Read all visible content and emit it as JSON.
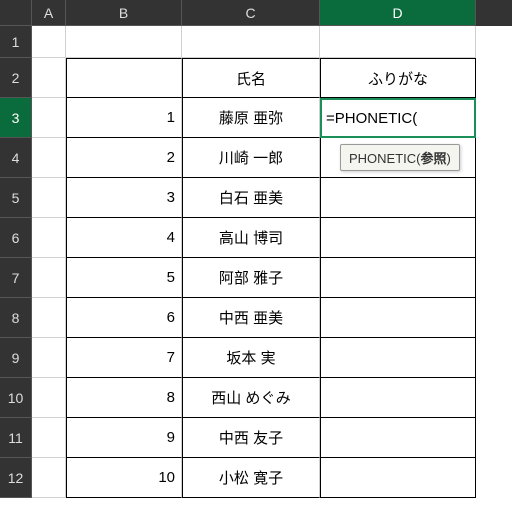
{
  "columns": [
    "A",
    "B",
    "C",
    "D"
  ],
  "rowNumbers": [
    "1",
    "2",
    "3",
    "4",
    "5",
    "6",
    "7",
    "8",
    "9",
    "10",
    "11",
    "12"
  ],
  "activeRow": 3,
  "activeCol": "D",
  "headers": {
    "name": "氏名",
    "furigana": "ふりがな"
  },
  "tableRows": [
    {
      "num": "1",
      "name": "藤原  亜弥"
    },
    {
      "num": "2",
      "name": "川崎  一郎"
    },
    {
      "num": "3",
      "name": "白石  亜美"
    },
    {
      "num": "4",
      "name": "高山  博司"
    },
    {
      "num": "5",
      "name": "阿部  雅子"
    },
    {
      "num": "6",
      "name": "中西  亜美"
    },
    {
      "num": "7",
      "name": "坂本  実"
    },
    {
      "num": "8",
      "name": "西山  めぐみ"
    },
    {
      "num": "9",
      "name": "中西  友子"
    },
    {
      "num": "10",
      "name": "小松  寛子"
    }
  ],
  "editingFormula": "=PHONETIC(",
  "tooltip": {
    "func": "PHONETIC",
    "arg": "参照"
  }
}
